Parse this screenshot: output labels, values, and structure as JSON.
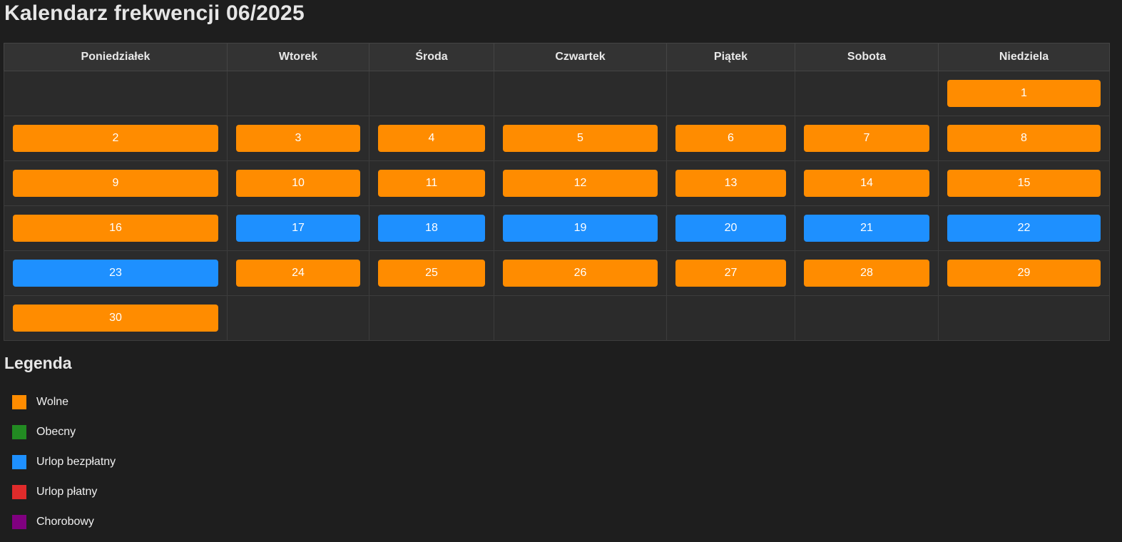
{
  "title": "Kalendarz frekwencji 06/2025",
  "colors": {
    "wolne": "#ff8c00",
    "obecny": "#228b22",
    "urlop_bezplatny": "#1e90ff",
    "urlop_platny": "#e02b2b",
    "chorobowy": "#800080"
  },
  "weekdays": [
    "Poniedziałek",
    "Wtorek",
    "Środa",
    "Czwartek",
    "Piątek",
    "Sobota",
    "Niedziela"
  ],
  "weeks": [
    [
      null,
      null,
      null,
      null,
      null,
      null,
      {
        "day": "1",
        "status": "wolne"
      }
    ],
    [
      {
        "day": "2",
        "status": "wolne"
      },
      {
        "day": "3",
        "status": "wolne"
      },
      {
        "day": "4",
        "status": "wolne"
      },
      {
        "day": "5",
        "status": "wolne"
      },
      {
        "day": "6",
        "status": "wolne"
      },
      {
        "day": "7",
        "status": "wolne"
      },
      {
        "day": "8",
        "status": "wolne"
      }
    ],
    [
      {
        "day": "9",
        "status": "wolne"
      },
      {
        "day": "10",
        "status": "wolne"
      },
      {
        "day": "11",
        "status": "wolne"
      },
      {
        "day": "12",
        "status": "wolne"
      },
      {
        "day": "13",
        "status": "wolne"
      },
      {
        "day": "14",
        "status": "wolne"
      },
      {
        "day": "15",
        "status": "wolne"
      }
    ],
    [
      {
        "day": "16",
        "status": "wolne"
      },
      {
        "day": "17",
        "status": "urlop_bezplatny"
      },
      {
        "day": "18",
        "status": "urlop_bezplatny"
      },
      {
        "day": "19",
        "status": "urlop_bezplatny"
      },
      {
        "day": "20",
        "status": "urlop_bezplatny"
      },
      {
        "day": "21",
        "status": "urlop_bezplatny"
      },
      {
        "day": "22",
        "status": "urlop_bezplatny"
      }
    ],
    [
      {
        "day": "23",
        "status": "urlop_bezplatny"
      },
      {
        "day": "24",
        "status": "wolne"
      },
      {
        "day": "25",
        "status": "wolne"
      },
      {
        "day": "26",
        "status": "wolne"
      },
      {
        "day": "27",
        "status": "wolne"
      },
      {
        "day": "28",
        "status": "wolne"
      },
      {
        "day": "29",
        "status": "wolne"
      }
    ],
    [
      {
        "day": "30",
        "status": "wolne"
      },
      null,
      null,
      null,
      null,
      null,
      null
    ]
  ],
  "legend": {
    "title": "Legenda",
    "items": [
      {
        "label": "Wolne",
        "status": "wolne"
      },
      {
        "label": "Obecny",
        "status": "obecny"
      },
      {
        "label": "Urlop bezpłatny",
        "status": "urlop_bezplatny"
      },
      {
        "label": "Urlop płatny",
        "status": "urlop_platny"
      },
      {
        "label": "Chorobowy",
        "status": "chorobowy"
      }
    ]
  }
}
